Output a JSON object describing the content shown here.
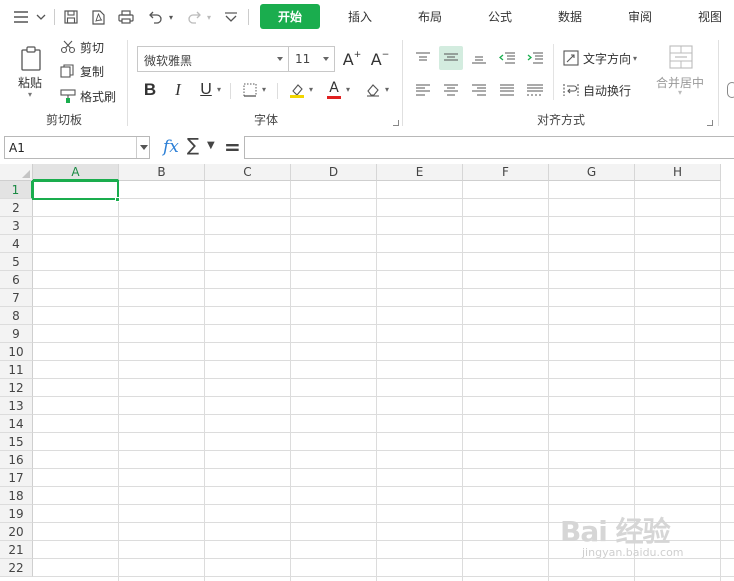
{
  "menubar": {
    "tabs": [
      {
        "label": "开始",
        "active": true
      },
      {
        "label": "插入"
      },
      {
        "label": "布局"
      },
      {
        "label": "公式"
      },
      {
        "label": "数据"
      },
      {
        "label": "审阅"
      },
      {
        "label": "视图"
      }
    ],
    "accent_color": "#1aad4e"
  },
  "ribbon": {
    "clipboard": {
      "paste_label": "粘贴",
      "cut_label": "剪切",
      "copy_label": "复制",
      "format_painter_label": "格式刷",
      "group_label": "剪切板"
    },
    "font": {
      "font_name": "微软雅黑",
      "font_size": "11",
      "bold": "B",
      "italic": "I",
      "underline": "U",
      "font_color_glyph": "A",
      "increase_font": "A",
      "decrease_font": "A",
      "group_label": "字体"
    },
    "alignment": {
      "text_direction_label": "文字方向",
      "wrap_text_label": "自动换行",
      "merge_center_label": "合并居中",
      "group_label": "对齐方式"
    }
  },
  "formulabar": {
    "name_box": "A1",
    "fx": "fx",
    "sum": "∑",
    "equals": "=",
    "formula_value": ""
  },
  "grid": {
    "columns": [
      "A",
      "B",
      "C",
      "D",
      "E",
      "F",
      "G",
      "H"
    ],
    "rows": [
      "1",
      "2",
      "3",
      "4",
      "5",
      "6",
      "7",
      "8",
      "9",
      "10",
      "11",
      "12",
      "13",
      "14",
      "15",
      "16",
      "17",
      "18",
      "19",
      "20",
      "21",
      "22"
    ],
    "active_cell": "A1"
  },
  "watermark": {
    "brand": "Bai 经验",
    "url": "jingyan.baidu.com"
  }
}
